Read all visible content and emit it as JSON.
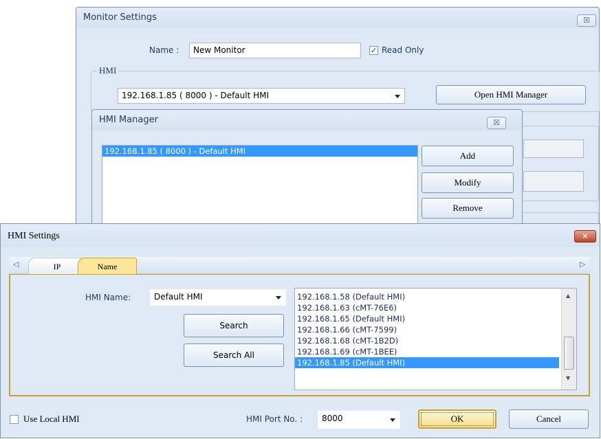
{
  "monitor_settings": {
    "title": "Monitor Settings",
    "close_glyph": "☒",
    "name_label": "Name :",
    "name_value": "New Monitor",
    "read_only_label": "Read Only",
    "read_only_checked": true,
    "hmi_group_label": "HMI",
    "hmi_select_value": "192.168.1.85 ( 8000 )  - Default HMI",
    "open_manager_label": "Open HMI Manager"
  },
  "hmi_manager": {
    "title": "HMI Manager",
    "close_glyph": "☒",
    "items": [
      "192.168.1.85 ( 8000 )  - Default HMI"
    ],
    "selected_index": 0,
    "add_label": "Add",
    "modify_label": "Modify",
    "remove_label": "Remove"
  },
  "hmi_settings": {
    "title": "HMI Settings",
    "close_glyph": "×",
    "tabs": [
      {
        "label": "IP",
        "active": false
      },
      {
        "label": "Name",
        "active": true
      }
    ],
    "tab_scroll_left": "◁",
    "tab_scroll_right": "▷",
    "hmi_name_label": "HMI Name:",
    "hmi_name_value": "Default HMI",
    "search_label": "Search",
    "search_all_label": "Search All",
    "results": [
      "192.168.1.58 (Default HMI)",
      "192.168.1.63 (cMT-76E6)",
      "192.168.1.65 (Default HMI)",
      "192.168.1.66 (cMT-7599)",
      "192.168.1.68 (cMT-1B2D)",
      "192.168.1.69 (cMT-1BEE)",
      "192.168.1.85 (Default HMI)"
    ],
    "selected_result": 6,
    "scroll_up": "▲",
    "scroll_down": "▼",
    "use_local_label": "Use Local HMI",
    "use_local_checked": false,
    "port_label": "HMI Port No. :",
    "port_value": "8000",
    "ok_label": "OK",
    "cancel_label": "Cancel"
  },
  "colors": {
    "dialog_bg": "#dfe9f5",
    "selection": "#3399ff",
    "active_tab": "#fde59a",
    "tab_border": "#c9a227"
  }
}
